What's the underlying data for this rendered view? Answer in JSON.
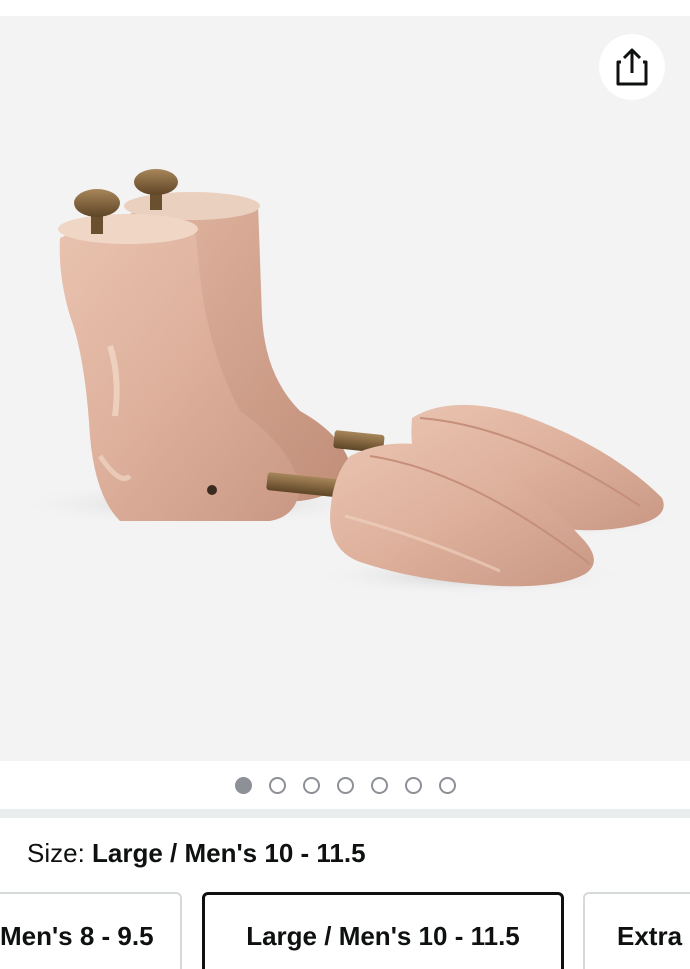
{
  "share": {
    "icon": "share-icon"
  },
  "gallery": {
    "image_alt": "Cedar wood shoe trees pair",
    "dots": [
      {
        "active": true
      },
      {
        "active": false
      },
      {
        "active": false
      },
      {
        "active": false
      },
      {
        "active": false
      },
      {
        "active": false
      },
      {
        "active": false
      }
    ]
  },
  "size": {
    "label": "Size: ",
    "selected": "Large / Men's 10 - 11.5",
    "options": [
      {
        "label": "Men's 8 - 9.5",
        "selected": false
      },
      {
        "label": "Large / Men's 10 - 11.5",
        "selected": true
      },
      {
        "label": "Extra",
        "selected": false
      }
    ]
  },
  "colors": {
    "gallery_bg": "#f3f3f3",
    "divider": "#eaeded",
    "dot": "#8d9096",
    "option_border": "#d5d9d9",
    "selected_border": "#0f1111"
  }
}
